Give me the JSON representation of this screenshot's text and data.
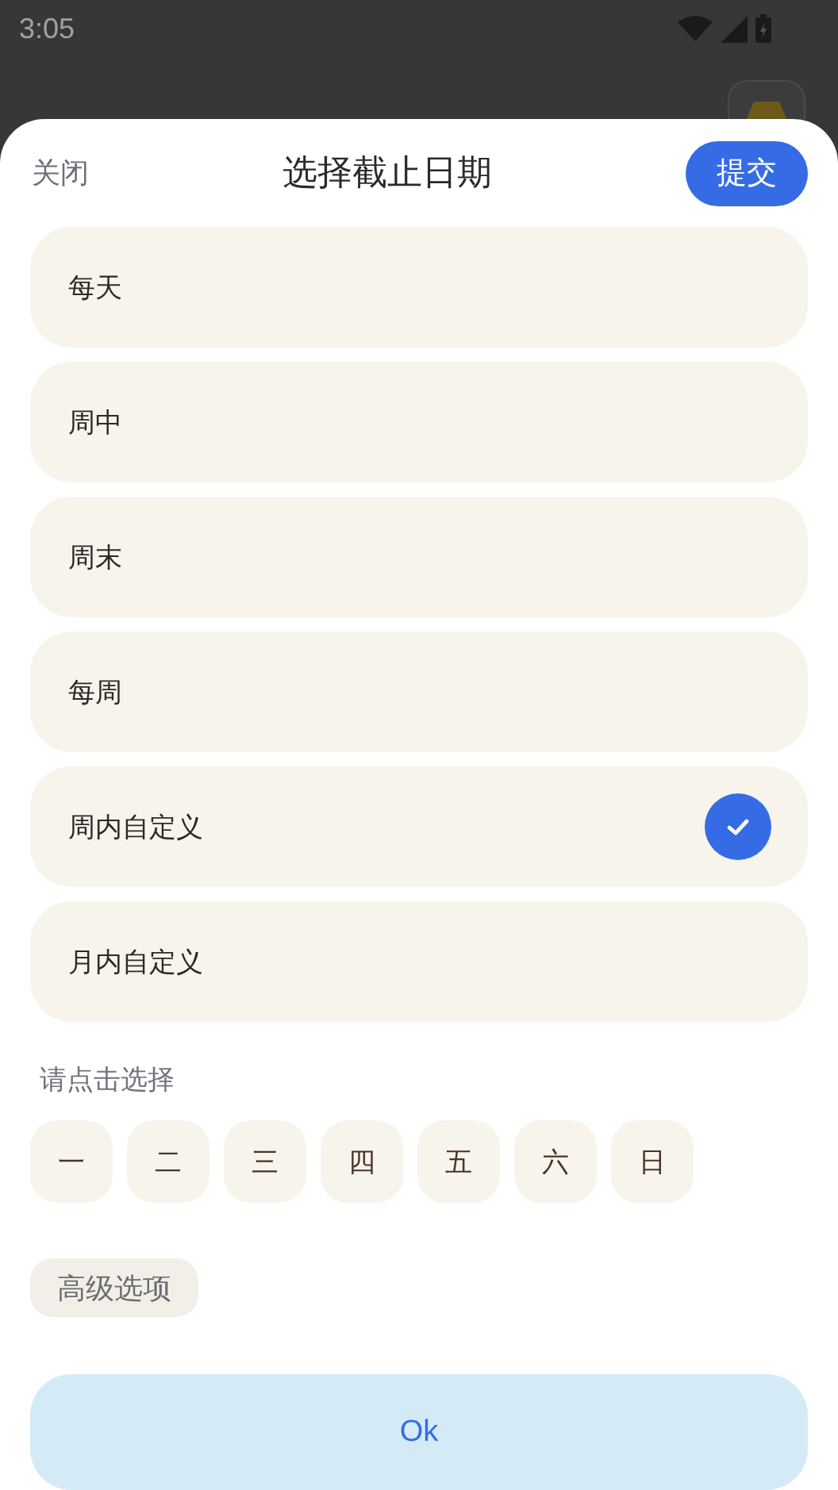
{
  "status_bar": {
    "time": "3:05"
  },
  "sheet": {
    "close": "关闭",
    "title": "选择截止日期",
    "submit": "提交"
  },
  "options": [
    {
      "label": "每天",
      "selected": false
    },
    {
      "label": "周中",
      "selected": false
    },
    {
      "label": "周末",
      "selected": false
    },
    {
      "label": "每周",
      "selected": false
    },
    {
      "label": "周内自定义",
      "selected": true
    },
    {
      "label": "月内自定义",
      "selected": false
    }
  ],
  "day_prompt": "请点击选择",
  "days": [
    {
      "label": "一",
      "selected": false
    },
    {
      "label": "二",
      "selected": false
    },
    {
      "label": "三",
      "selected": false
    },
    {
      "label": "四",
      "selected": false
    },
    {
      "label": "五",
      "selected": false
    },
    {
      "label": "六",
      "selected": false
    },
    {
      "label": "日",
      "selected": false
    }
  ],
  "advanced": "高级选项",
  "ok": "Ok"
}
